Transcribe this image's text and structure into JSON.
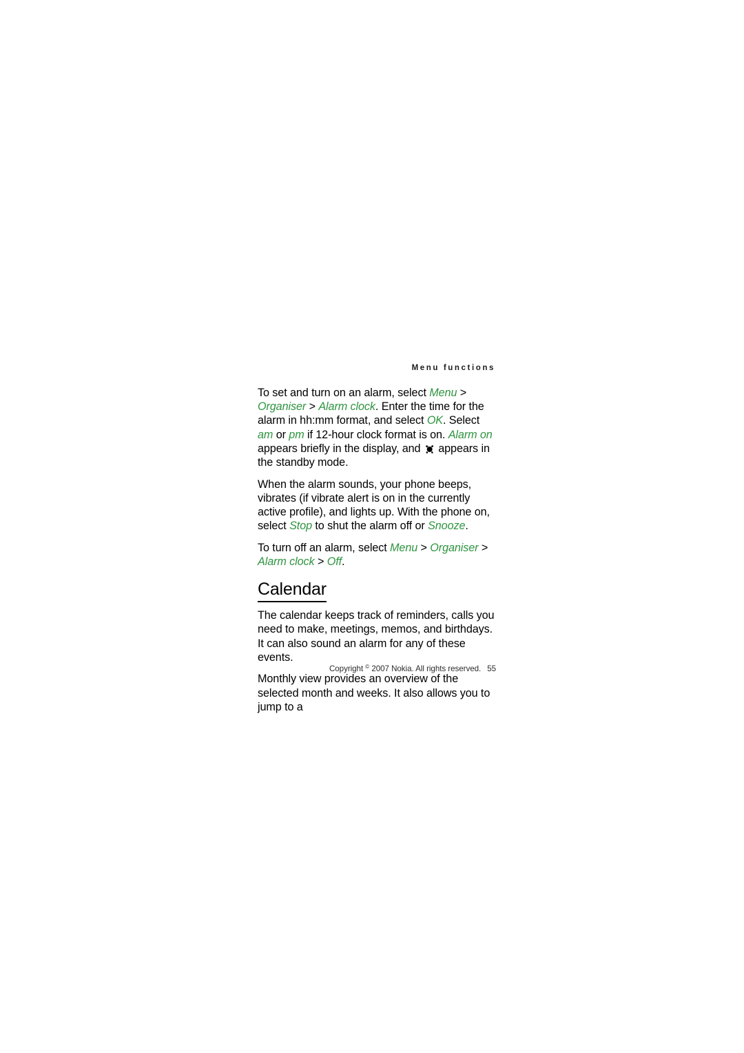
{
  "header": {
    "running_head": "Menu functions"
  },
  "content": {
    "paragraphs": [
      {
        "id": "set-alarm",
        "runs": [
          {
            "t": "To set and turn on an alarm, select ",
            "s": "plain"
          },
          {
            "t": "Menu",
            "s": "ui"
          },
          {
            "t": " > ",
            "s": "sep"
          },
          {
            "t": "Organiser",
            "s": "ui"
          },
          {
            "t": " > ",
            "s": "sep"
          },
          {
            "t": "Alarm clock",
            "s": "ui"
          },
          {
            "t": ". Enter the time for the alarm in hh:mm format, and select ",
            "s": "plain"
          },
          {
            "t": "OK",
            "s": "ui"
          },
          {
            "t": ". Select ",
            "s": "plain"
          },
          {
            "t": "am",
            "s": "ui"
          },
          {
            "t": " or ",
            "s": "plain"
          },
          {
            "t": "pm",
            "s": "ui"
          },
          {
            "t": " if 12-hour clock format is on. ",
            "s": "plain"
          },
          {
            "t": "Alarm on",
            "s": "ui"
          },
          {
            "t": " appears briefly in the display, and ",
            "s": "plain"
          },
          {
            "t": "",
            "s": "icon",
            "icon": "alarm-clock-icon"
          },
          {
            "t": " appears in the standby mode.",
            "s": "plain"
          }
        ]
      },
      {
        "id": "alarm-sounds",
        "runs": [
          {
            "t": "When the alarm sounds, your phone beeps, vibrates (if vibrate alert is on in the currently active profile), and lights up. With the phone on, select ",
            "s": "plain"
          },
          {
            "t": "Stop",
            "s": "ui"
          },
          {
            "t": " to shut the alarm off or ",
            "s": "plain"
          },
          {
            "t": "Snooze",
            "s": "ui"
          },
          {
            "t": ".",
            "s": "plain"
          }
        ]
      },
      {
        "id": "turn-off-alarm",
        "runs": [
          {
            "t": "To turn off an alarm, select ",
            "s": "plain"
          },
          {
            "t": "Menu",
            "s": "ui"
          },
          {
            "t": " > ",
            "s": "sep"
          },
          {
            "t": "Organiser",
            "s": "ui"
          },
          {
            "t": " > ",
            "s": "sep"
          },
          {
            "t": "Alarm clock",
            "s": "ui"
          },
          {
            "t": " > ",
            "s": "sep"
          },
          {
            "t": "Off",
            "s": "ui"
          },
          {
            "t": ".",
            "s": "plain"
          }
        ]
      }
    ],
    "section_heading": "Calendar",
    "calendar_paragraphs": [
      {
        "id": "calendar-intro",
        "runs": [
          {
            "t": "The calendar keeps track of reminders, calls you need to make, meetings, memos, and birthdays. It can also sound an alarm for any of these events.",
            "s": "plain"
          }
        ]
      },
      {
        "id": "monthly-view",
        "runs": [
          {
            "t": "Monthly view provides an overview of the selected month and weeks. It also allows you to jump to a",
            "s": "plain"
          }
        ]
      }
    ]
  },
  "footer": {
    "copyright_prefix": "Copyright ",
    "copyright_symbol": "©",
    "copyright_suffix": " 2007 Nokia. All rights reserved.",
    "page_number": "55"
  },
  "colors": {
    "ui_term_green": "#2f9440",
    "body_text": "#000000",
    "footer_text": "#2b2b2b",
    "page_background": "#ffffff"
  }
}
